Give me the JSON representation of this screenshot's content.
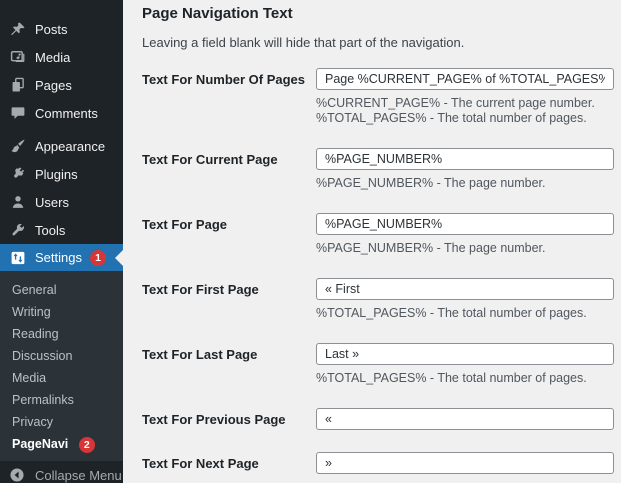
{
  "sidebar": {
    "menu": [
      {
        "label": "Posts",
        "icon": "pushpin-icon"
      },
      {
        "label": "Media",
        "icon": "media-frame-icon"
      },
      {
        "label": "Pages",
        "icon": "stacked-pages-icon"
      },
      {
        "label": "Comments",
        "icon": "speech-bubble-icon"
      },
      {
        "label": "Appearance",
        "icon": "paintbrush-icon"
      },
      {
        "label": "Plugins",
        "icon": "plug-icon"
      },
      {
        "label": "Users",
        "icon": "person-icon"
      },
      {
        "label": "Tools",
        "icon": "wrench-icon"
      },
      {
        "label": "Settings",
        "icon": "sliders-icon",
        "badge": "1"
      }
    ],
    "submenu": [
      {
        "label": "General"
      },
      {
        "label": "Writing"
      },
      {
        "label": "Reading"
      },
      {
        "label": "Discussion"
      },
      {
        "label": "Media"
      },
      {
        "label": "Permalinks"
      },
      {
        "label": "Privacy"
      },
      {
        "label": "PageNavi",
        "badge": "2"
      }
    ],
    "collapse_label": "Collapse Menu"
  },
  "main": {
    "title": "Page Navigation Text",
    "subtitle": "Leaving a field blank will hide that part of the navigation.",
    "fields": [
      {
        "label": "Text For Number Of Pages",
        "value": "Page %CURRENT_PAGE% of %TOTAL_PAGES%",
        "help": [
          "%CURRENT_PAGE% - The current page number.",
          "%TOTAL_PAGES% - The total number of pages."
        ]
      },
      {
        "label": "Text For Current Page",
        "value": "%PAGE_NUMBER%",
        "help": [
          "%PAGE_NUMBER% - The page number."
        ]
      },
      {
        "label": "Text For Page",
        "value": "%PAGE_NUMBER%",
        "help": [
          "%PAGE_NUMBER% - The page number."
        ]
      },
      {
        "label": "Text For First Page",
        "value": "« First",
        "help": [
          "%TOTAL_PAGES% - The total number of pages."
        ]
      },
      {
        "label": "Text For Last Page",
        "value": "Last »",
        "help": [
          "%TOTAL_PAGES% - The total number of pages."
        ]
      },
      {
        "label": "Text For Previous Page",
        "value": "«",
        "help": []
      },
      {
        "label": "Text For Next Page",
        "value": "»",
        "help": []
      }
    ]
  },
  "colors": {
    "accent": "#2271b1",
    "badge": "#d63638",
    "sidebar_bg": "#1d2327",
    "submenu_bg": "#2c3338",
    "content_bg": "#f0f0f1",
    "input_border": "#8c8f94"
  }
}
